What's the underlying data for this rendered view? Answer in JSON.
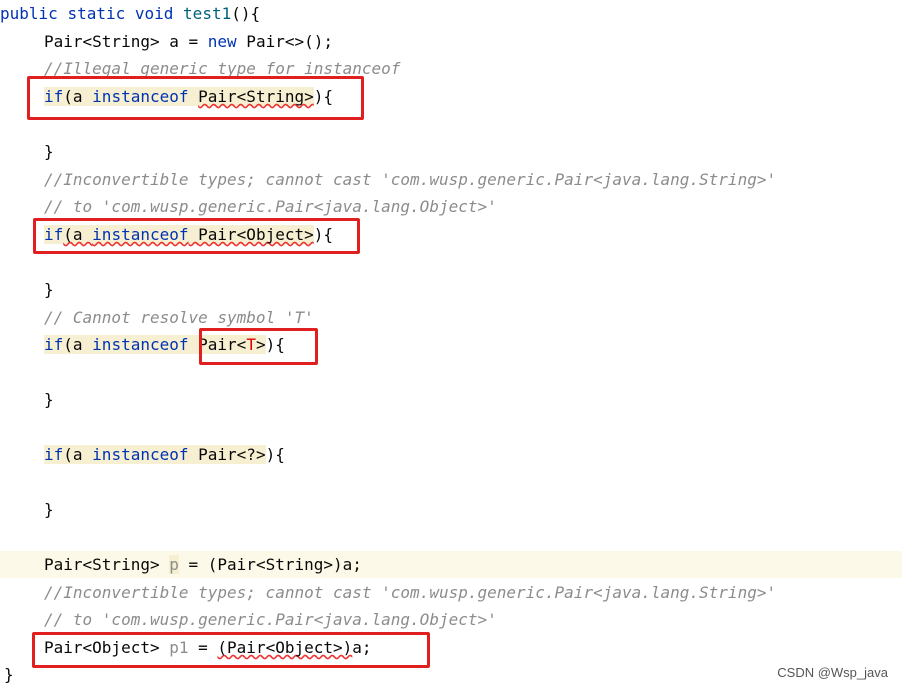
{
  "code": {
    "l1": {
      "kw1": "public",
      "kw2": "static",
      "kw3": "void",
      "name": "test1",
      "rest": "(){"
    },
    "l2": {
      "a": "Pair<String> a = ",
      "kw": "new",
      "b": " Pair<>();"
    },
    "l3": {
      "comment": "//Illegal generic type for instanceof"
    },
    "l4": {
      "kw_if": "if",
      "p1": "(a ",
      "kw_inst": "instanceof",
      "sp": " ",
      "type": "Pair<String>",
      "end": "){"
    },
    "l6": {
      "text": "}"
    },
    "l7": {
      "comment": "//Inconvertible types; cannot cast 'com.wusp.generic.Pair<java.lang.String>'"
    },
    "l8": {
      "comment": "// to 'com.wusp.generic.Pair<java.lang.Object>'"
    },
    "l9": {
      "kw_if": "if",
      "p1": "(a ",
      "kw_inst": "instanceof",
      "sp": " ",
      "type": "Pair<Object>",
      "end": "){"
    },
    "l11": {
      "text": "}"
    },
    "l12": {
      "comment": "// Cannot resolve symbol 'T'"
    },
    "l13": {
      "kw_if": "if",
      "p1": "(a ",
      "kw_inst": "instanceof",
      "sp": " ",
      "t1": "Pair<",
      "t2": "T",
      "t3": ">",
      "end": "){"
    },
    "l15": {
      "text": "}"
    },
    "l17": {
      "kw_if": "if",
      "p1": "(a ",
      "kw_inst": "instanceof",
      "sp": " ",
      "type": "Pair<?>",
      "end": "){"
    },
    "l19": {
      "text": "}"
    },
    "l21": {
      "a": "Pair<String> ",
      "var": "p",
      "b": " = (Pair<String>)a;"
    },
    "l22": {
      "comment": "//Inconvertible types; cannot cast 'com.wusp.generic.Pair<java.lang.String>'"
    },
    "l23": {
      "comment": "// to 'com.wusp.generic.Pair<java.lang.Object>'"
    },
    "l24": {
      "a": "Pair<Object> ",
      "var": "p1",
      "b": " = ",
      "cast": "(Pair<Object>)",
      "c": "a;"
    },
    "l25": {
      "text": "}"
    }
  },
  "watermark": "CSDN @Wsp_java",
  "colors": {
    "keyword": "#0033b3",
    "comment": "#8c8c8c",
    "highlight": "#f7efd1",
    "annotation_box": "#e02020"
  }
}
